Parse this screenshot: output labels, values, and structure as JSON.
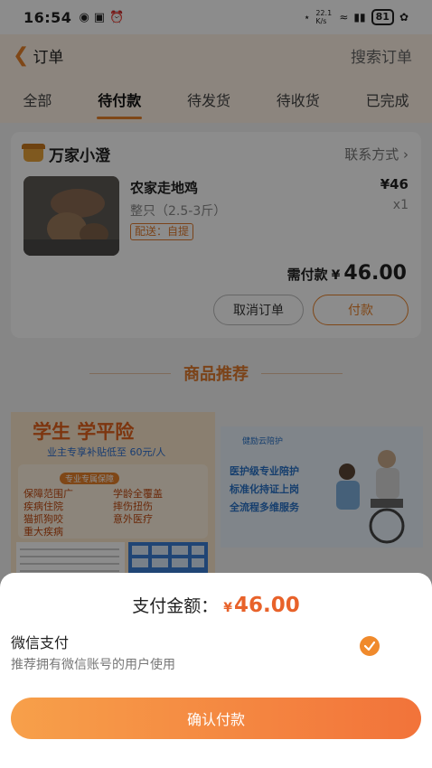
{
  "status_bar": {
    "time": "16:54",
    "network_speed": "22.1 K/s",
    "battery": "81"
  },
  "header": {
    "title": "订单",
    "search_label": "搜索订单"
  },
  "tabs": [
    {
      "label": "全部"
    },
    {
      "label": "待付款",
      "active": true
    },
    {
      "label": "待发货"
    },
    {
      "label": "待收货"
    },
    {
      "label": "已完成"
    }
  ],
  "order": {
    "shop_name": "万家小澄",
    "contact_label": "联系方式",
    "product_name": "农家走地鸡",
    "spec": "整只（2.5-3斤）",
    "delivery_tag": "配送：自提",
    "unit_price": "¥46",
    "quantity": "x1",
    "due_label": "需付款",
    "due_currency": "¥",
    "due_amount": "46.00",
    "cancel_label": "取消订单",
    "pay_label": "付款"
  },
  "recommend": {
    "title": "商品推荐",
    "banner1": {
      "headline": "学生 学平险",
      "subline": "业主专享补贴低至 60元/人",
      "pill": "专业专属保障",
      "items": [
        "保障范围广",
        "学龄全覆盖",
        "疾病住院",
        "摔伤扭伤",
        "猫抓狗咬",
        "意外医疗",
        "重大疾病"
      ]
    },
    "banner2": {
      "brand": "健励云陪护",
      "items": [
        "医护级专业陪护",
        "标准化持证上岗",
        "全流程多维服务"
      ]
    }
  },
  "payment_sheet": {
    "amount_label": "支付金额：",
    "amount_currency": "¥",
    "amount_value": "46.00",
    "method_name": "微信支付",
    "method_desc": "推荐拥有微信账号的用户使用",
    "method_selected": true,
    "confirm_label": "确认付款"
  },
  "colors": {
    "accent": "#e8822a",
    "amount": "#e8622a"
  }
}
